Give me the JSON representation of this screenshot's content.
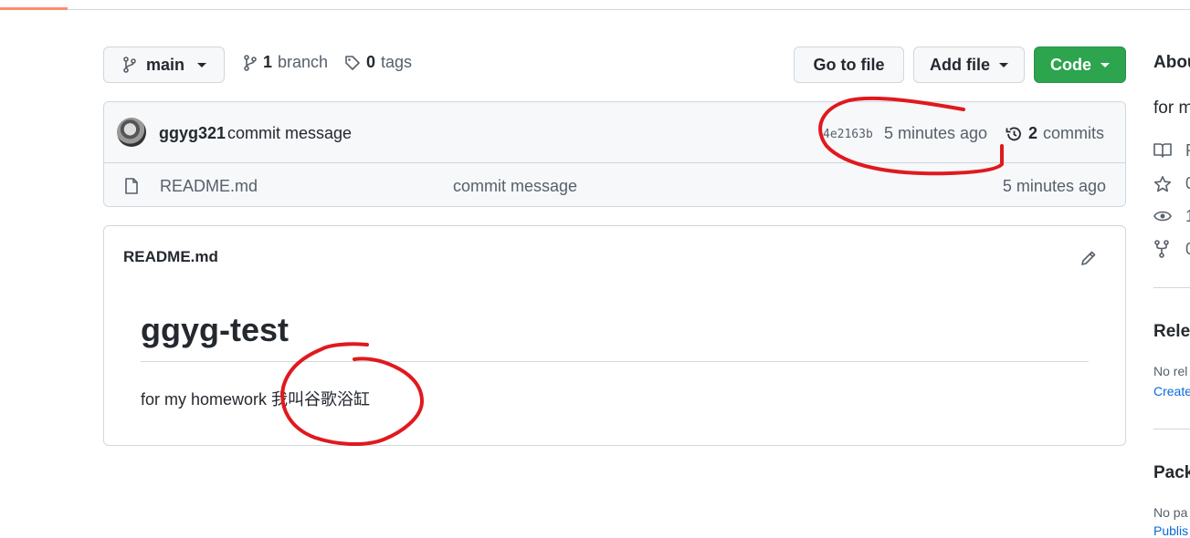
{
  "branch": {
    "name": "main",
    "branch_count": "1",
    "branch_label": "branch",
    "tag_count": "0",
    "tag_label": "tags"
  },
  "actions": {
    "go_to_file": "Go to file",
    "add_file": "Add file",
    "code": "Code"
  },
  "commit": {
    "author": "ggyg321",
    "message": "commit message",
    "sha": "4e2163b",
    "time": "5 minutes ago",
    "count": "2",
    "count_label": "commits"
  },
  "files": [
    {
      "name": "README.md",
      "message": "commit message",
      "time": "5 minutes ago"
    }
  ],
  "readme": {
    "filename": "README.md",
    "heading": "ggyg-test",
    "body": "for my homework 我叫谷歌浴缸"
  },
  "sidebar": {
    "about_title": "Abou",
    "description": "for m",
    "readme_label": "R",
    "stars": "0",
    "watchers": "1",
    "forks": "0",
    "releases_title": "Rele",
    "releases_text": "No rel",
    "releases_link": "Create",
    "packages_title": "Pack",
    "packages_text": "No pa",
    "packages_link": "Publis"
  },
  "colors": {
    "accent": "#2da44e",
    "annotation": "#e0191e",
    "tab_underline": "#fd8c73",
    "link": "#0969da"
  }
}
